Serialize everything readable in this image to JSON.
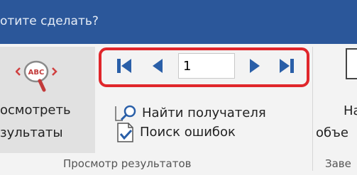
{
  "title_bar": {
    "tell_me_text": "отите сделать?"
  },
  "ribbon": {
    "review_results": {
      "icon": "abc-magnifier-icon",
      "line1": "осмотреть",
      "line2": "зультаты"
    },
    "navigation": {
      "first_icon": "first-record-icon",
      "previous_icon": "previous-record-icon",
      "record_value": "1",
      "next_icon": "next-record-icon",
      "last_icon": "last-record-icon"
    },
    "find_recipient": {
      "icon": "find-recipient-icon",
      "label": "Найти получателя"
    },
    "check_errors": {
      "icon": "check-errors-icon",
      "label": "Поиск ошибок"
    },
    "group_label": "Просмотр результатов",
    "right_group": {
      "line1": "На",
      "line2": "объе",
      "group_label": "Заве"
    }
  },
  "colors": {
    "title_bar": "#2b579a",
    "highlight": "#e0262b",
    "nav_icon": "#2a5fa8"
  }
}
